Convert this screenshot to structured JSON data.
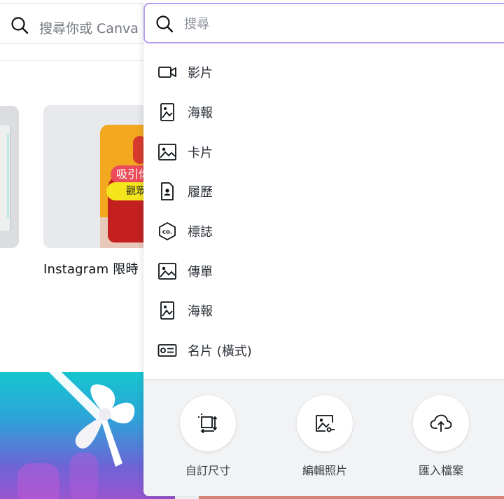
{
  "background": {
    "search_placeholder": "搜尋你或 Canva",
    "thumbnail_caption": "Instagram 限時",
    "poster_text_1": "吸引你",
    "poster_text_2": "觀眾"
  },
  "search": {
    "placeholder": "搜尋",
    "value": ""
  },
  "suggestions": [
    {
      "label": "影片",
      "icon": "video-icon"
    },
    {
      "label": "海報",
      "icon": "poster-icon"
    },
    {
      "label": "卡片",
      "icon": "image-icon"
    },
    {
      "label": "履歷",
      "icon": "resume-icon"
    },
    {
      "label": "標誌",
      "icon": "logo-icon"
    },
    {
      "label": "傳單",
      "icon": "image-icon"
    },
    {
      "label": "海報",
      "icon": "poster-icon"
    },
    {
      "label": "名片 (橫式)",
      "icon": "business-card-icon"
    }
  ],
  "actions": [
    {
      "label": "自訂尺寸",
      "icon": "custom-size-icon"
    },
    {
      "label": "編輯照片",
      "icon": "edit-photo-icon"
    },
    {
      "label": "匯入檔案",
      "icon": "upload-cloud-icon"
    }
  ],
  "colors": {
    "focus_border": "#b79ef0",
    "panel_bg": "#f2f3f5",
    "text": "#2b3038"
  }
}
